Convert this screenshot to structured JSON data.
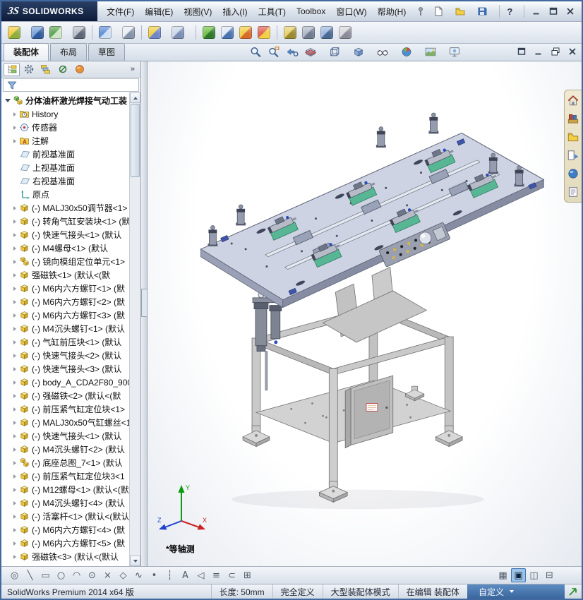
{
  "titlebar": {
    "brand_prefix": "3S",
    "brand": "SOLIDWORKS",
    "menus": [
      "文件(F)",
      "编辑(E)",
      "视图(V)",
      "插入(I)",
      "工具(T)",
      "Toolbox",
      "窗口(W)",
      "帮助(H)"
    ],
    "quick_tools": [
      {
        "name": "new-document",
        "icon": "new-doc",
        "dd": true
      },
      {
        "name": "open-document",
        "icon": "open-doc",
        "dd": true
      },
      {
        "name": "save-document",
        "icon": "save-doc",
        "dd": true
      }
    ],
    "help_label": "?"
  },
  "toolbar": {
    "items": [
      {
        "name": "insert-components",
        "c1": "#f2cf44",
        "c2": "#8fae3b",
        "dd": true
      },
      {
        "name": "mate",
        "c1": "#7ba3d9",
        "c2": "#2f5a9e"
      },
      {
        "name": "linear-component-pattern",
        "c1": "#5aa24d",
        "c2": "#cfe6c8",
        "dd": true
      },
      {
        "name": "smart-fasteners",
        "c1": "#b9bfc9",
        "c2": "#5c6675"
      },
      {
        "sep": true
      },
      {
        "name": "move-component",
        "c1": "#5f8fd6",
        "c2": "#cfe0f5",
        "dd": true
      },
      {
        "name": "show-hidden-components",
        "c1": "#e8edf4",
        "c2": "#8593a8"
      },
      {
        "sep": true
      },
      {
        "name": "assembly-features",
        "c1": "#f2cf44",
        "c2": "#6f86c8",
        "dd": true
      },
      {
        "name": "reference-geometry",
        "c1": "#cdd8ea",
        "c2": "#7a8eb5",
        "dd": true
      },
      {
        "sep": true
      },
      {
        "name": "new-motion-study",
        "c1": "#74c04a",
        "c2": "#2f7a2a"
      },
      {
        "name": "bill-of-materials",
        "c1": "#dfe8f5",
        "c2": "#4a72b0"
      },
      {
        "name": "exploded-view",
        "c1": "#f2cf44",
        "c2": "#d86a2a"
      },
      {
        "name": "interference-detection",
        "c1": "#e06050",
        "c2": "#f2cf44"
      },
      {
        "sep": true
      },
      {
        "name": "measure",
        "c1": "#e8d070",
        "c2": "#9a8a30"
      },
      {
        "name": "mass-properties",
        "c1": "#b0b8c8",
        "c2": "#707a90"
      },
      {
        "name": "section-properties",
        "c1": "#9db8dd",
        "c2": "#4a6a94"
      },
      {
        "name": "spell-checker",
        "c1": "#d8d8dc",
        "c2": "#8a8a99"
      }
    ]
  },
  "tabs": {
    "items": [
      "装配体",
      "布局",
      "草图"
    ],
    "active": 0
  },
  "headsup": {
    "items": [
      {
        "name": "zoom-to-fit",
        "icon": "zoom-fit"
      },
      {
        "name": "zoom-to-area",
        "icon": "zoom-area"
      },
      {
        "name": "previous-view",
        "icon": "prev-view"
      },
      {
        "name": "section-view",
        "icon": "section-view",
        "dd": true
      },
      {
        "name": "view-orientation",
        "icon": "view-cube",
        "dd": true
      },
      {
        "name": "display-style",
        "icon": "display-style",
        "dd": true
      },
      {
        "name": "hide-show-items",
        "icon": "hide-show",
        "dd": true
      },
      {
        "name": "edit-appearance",
        "icon": "appearance-ball",
        "dd": true
      },
      {
        "name": "apply-scene",
        "icon": "apply-scene",
        "dd": true
      },
      {
        "name": "view-settings",
        "icon": "view-settings",
        "dd": true
      }
    ]
  },
  "doc_controls": [
    {
      "name": "commandmanager-options",
      "icon": "doc-max"
    },
    {
      "name": "document-minimize",
      "icon": "doc-min"
    },
    {
      "name": "document-restore",
      "icon": "doc-restore"
    },
    {
      "name": "document-close",
      "icon": "doc-close"
    }
  ],
  "feature_panel": {
    "tabs": [
      {
        "name": "featuremanager-tab",
        "icon": "pm-feature",
        "active": true
      },
      {
        "name": "propertymanager-tab",
        "icon": "pm-property"
      },
      {
        "name": "configurationmanager-tab",
        "icon": "pm-config"
      },
      {
        "name": "dimxpertmanager-tab",
        "icon": "pm-dimx"
      },
      {
        "name": "displaymanager-tab",
        "icon": "pm-display"
      }
    ],
    "overflow": "»",
    "root": {
      "icon": "root-assembly",
      "label": "分体油杯激光焊接气动工装"
    },
    "items": [
      {
        "icon": "history",
        "label": "History",
        "tw": true
      },
      {
        "icon": "sensor",
        "label": "传感器",
        "tw": true
      },
      {
        "icon": "annotations",
        "label": "注解",
        "tw": true
      },
      {
        "icon": "plane",
        "label": "前视基准面"
      },
      {
        "icon": "plane",
        "label": "上视基准面"
      },
      {
        "icon": "plane",
        "label": "右视基准面"
      },
      {
        "icon": "origin",
        "label": "原点"
      },
      {
        "icon": "part",
        "label": "(-) MALJ30x50调节器<1>",
        "tw": true
      },
      {
        "icon": "part",
        "label": "(-) 转角气缸安装块<1> (默认",
        "tw": true
      },
      {
        "icon": "part",
        "label": "(-) 快速气接头<1> (默认",
        "tw": true
      },
      {
        "icon": "part",
        "label": "(-) M4螺母<1> (默认",
        "tw": true
      },
      {
        "icon": "assembly",
        "label": "(-) 镜向模组定位单元<1>",
        "tw": true
      },
      {
        "icon": "part",
        "label": "强磁铁<1> (默认<(默",
        "tw": true
      },
      {
        "icon": "part",
        "label": "(-) M6内六方螺钉<1> (默",
        "tw": true
      },
      {
        "icon": "part",
        "label": "(-) M6内六方螺钉<2> (默",
        "tw": true
      },
      {
        "icon": "part",
        "label": "(-) M6内六方螺钉<3> (默",
        "tw": true
      },
      {
        "icon": "part",
        "label": "(-) M4沉头螺钉<1> (默认",
        "tw": true
      },
      {
        "icon": "part",
        "label": "(-) 气缸前压块<1> (默认",
        "tw": true
      },
      {
        "icon": "part",
        "label": "(-) 快速气接头<2> (默认",
        "tw": true
      },
      {
        "icon": "part",
        "label": "(-) 快速气接头<3> (默认",
        "tw": true
      },
      {
        "icon": "part",
        "label": "(-) body_A_CDA2F80_900_",
        "tw": true
      },
      {
        "icon": "part",
        "label": "(-) 强磁铁<2> (默认<(默",
        "tw": true
      },
      {
        "icon": "part",
        "label": "(-) 前压紧气缸定位块<1>",
        "tw": true
      },
      {
        "icon": "part",
        "label": "(-) MALJ30x50气缸螺丝<1",
        "tw": true
      },
      {
        "icon": "part",
        "label": "(-) 快速气接头<1> (默认",
        "tw": true
      },
      {
        "icon": "part",
        "label": "(-) M4沉头螺钉<2> (默认",
        "tw": true
      },
      {
        "icon": "assembly",
        "label": "(-) 底座总图_7<1> (默认",
        "tw": true
      },
      {
        "icon": "part",
        "label": "(-) 前压紧气缸定位块3<1",
        "tw": true
      },
      {
        "icon": "part",
        "label": "(-) M12螺母<1> (默认<(默",
        "tw": true
      },
      {
        "icon": "part",
        "label": "(-) M4沉头螺钉<4> (默认",
        "tw": true
      },
      {
        "icon": "part",
        "label": "(-) 活塞杆<1> (默认<(默认",
        "tw": true
      },
      {
        "icon": "part",
        "label": "(-) M6内六方螺钉<4> (默",
        "tw": true
      },
      {
        "icon": "part",
        "label": "(-) M6内六方螺钉<5> (默",
        "tw": true
      },
      {
        "icon": "part",
        "label": "强磁铁<3> (默认<(默认",
        "tw": true
      }
    ]
  },
  "task_pane": {
    "items": [
      {
        "name": "solidworks-resources",
        "icon": "tp-home"
      },
      {
        "name": "design-library",
        "icon": "tp-library"
      },
      {
        "name": "file-explorer",
        "icon": "tp-folder"
      },
      {
        "name": "view-palette",
        "icon": "tp-palette"
      },
      {
        "name": "appearances-scenes",
        "icon": "tp-sphere"
      },
      {
        "name": "custom-properties",
        "icon": "tp-props"
      }
    ]
  },
  "viewport": {
    "view_label": "*等轴测",
    "triad": {
      "x": "X",
      "y": "Y",
      "z": "Z"
    }
  },
  "sketch_toolbar": {
    "items": [
      {
        "name": "select-tool",
        "glyph": "◎"
      },
      {
        "name": "line-tool",
        "glyph": "╲"
      },
      {
        "name": "rectangle-tool",
        "glyph": "▭"
      },
      {
        "name": "circle-tool",
        "glyph": "○"
      },
      {
        "name": "arc-tool",
        "glyph": "◠"
      },
      {
        "name": "ellipse-tool",
        "glyph": "⊙"
      },
      {
        "name": "trim-entities-tool",
        "glyph": "×"
      },
      {
        "name": "polygon-tool",
        "glyph": "◇"
      },
      {
        "name": "spline-tool",
        "glyph": "∿"
      },
      {
        "name": "point-tool",
        "glyph": "•"
      },
      {
        "name": "centerline-tool",
        "glyph": "┆"
      },
      {
        "name": "text-tool",
        "glyph": "A"
      },
      {
        "name": "mirror-entities-tool",
        "glyph": "◁"
      },
      {
        "name": "offset-entities-tool",
        "glyph": "≡"
      },
      {
        "name": "convert-entities-tool",
        "glyph": "⊂"
      },
      {
        "name": "sketch-pattern-tool",
        "glyph": "⊞"
      },
      {
        "name": "grid-system",
        "glyph": "▦",
        "group": "right"
      },
      {
        "name": "single-viewport",
        "glyph": "▣",
        "group": "right",
        "active": true
      },
      {
        "name": "two-viewport",
        "glyph": "◫",
        "group": "right"
      },
      {
        "name": "four-viewport",
        "glyph": "⊟",
        "group": "right"
      }
    ]
  },
  "status_bar": {
    "product": "SolidWorks Premium 2014 x64 版",
    "fields": [
      "长度: 50mm",
      "完全定义",
      "大型装配体模式",
      "在编辑 装配体"
    ],
    "custom": "自定义"
  }
}
